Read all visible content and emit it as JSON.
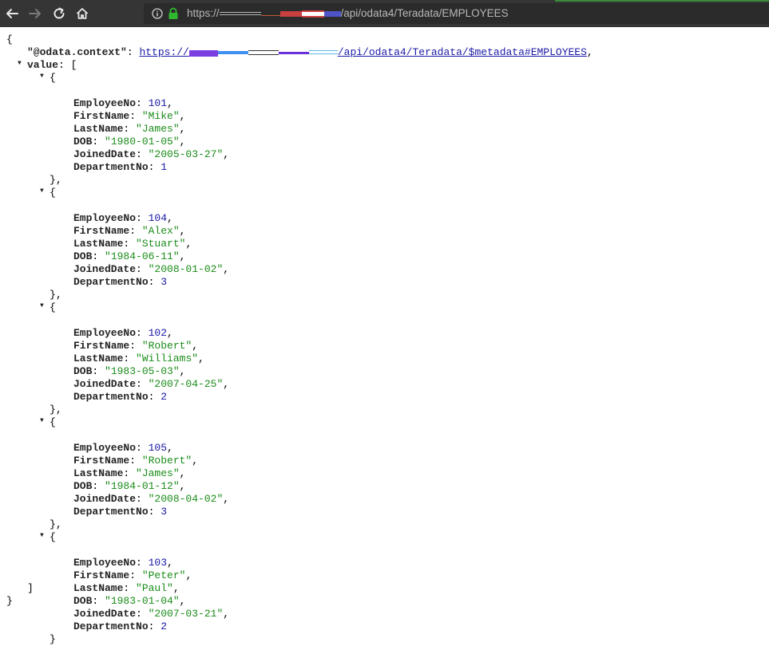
{
  "browser": {
    "url_prefix": "https://",
    "url_suffix": "/api/odata4/Teradata/EMPLOYEES"
  },
  "json": {
    "open_brace": "{",
    "close_brace": "}",
    "context_key": "\"@odata.context\"",
    "context_link_prefix": "https://",
    "context_link_suffix": "/api/odata4/Teradata/$metadata#EMPLOYEES",
    "value_key": "value",
    "open_bracket": "[",
    "close_bracket": "]",
    "records": [
      {
        "EmployeeNo": "101",
        "FirstName": "\"Mike\"",
        "LastName": "\"James\"",
        "DOB": "\"1980-01-05\"",
        "JoinedDate": "\"2005-03-27\"",
        "DepartmentNo": "1"
      },
      {
        "EmployeeNo": "104",
        "FirstName": "\"Alex\"",
        "LastName": "\"Stuart\"",
        "DOB": "\"1984-06-11\"",
        "JoinedDate": "\"2008-01-02\"",
        "DepartmentNo": "3"
      },
      {
        "EmployeeNo": "102",
        "FirstName": "\"Robert\"",
        "LastName": "\"Williams\"",
        "DOB": "\"1983-05-03\"",
        "JoinedDate": "\"2007-04-25\"",
        "DepartmentNo": "2"
      },
      {
        "EmployeeNo": "105",
        "FirstName": "\"Robert\"",
        "LastName": "\"James\"",
        "DOB": "\"1984-01-12\"",
        "JoinedDate": "\"2008-04-02\"",
        "DepartmentNo": "3"
      },
      {
        "EmployeeNo": "103",
        "FirstName": "\"Peter\"",
        "LastName": "\"Paul\"",
        "DOB": "\"1983-01-04\"",
        "JoinedDate": "\"2007-03-21\"",
        "DepartmentNo": "2"
      }
    ]
  },
  "colors": {
    "key": "#222222",
    "number": "#1a1aa6",
    "string": "#1a8c1a",
    "toolbar": "#353535"
  }
}
